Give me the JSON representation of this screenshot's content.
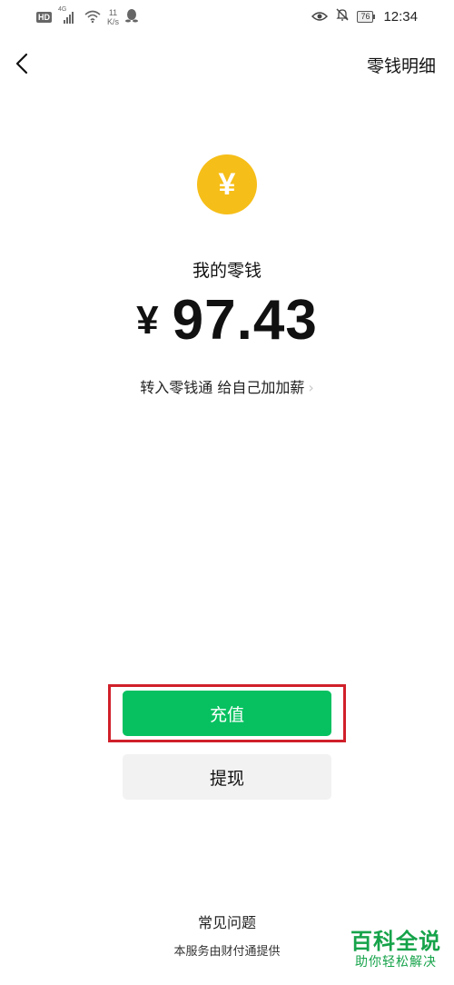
{
  "status_bar": {
    "hd": "HD",
    "network": "4G",
    "speed_value": "11",
    "speed_unit": "K/s",
    "battery": "76",
    "time": "12:34"
  },
  "header": {
    "detail_link": "零钱明细"
  },
  "coin": {
    "symbol": "¥",
    "color": "#F6BE18"
  },
  "balance": {
    "label": "我的零钱",
    "currency": "¥",
    "amount": "97.43"
  },
  "promo": {
    "text": "转入零钱通 给自己加加薪",
    "chevron": "›"
  },
  "actions": {
    "recharge_label": "充值",
    "withdraw_label": "提现",
    "primary_color": "#07C160",
    "highlight_color": "#d0202a"
  },
  "footer": {
    "faq": "常见问题",
    "provider": "本服务由财付通提供"
  },
  "watermark": {
    "title": "百科全说",
    "subtitle": "助你轻松解决"
  }
}
